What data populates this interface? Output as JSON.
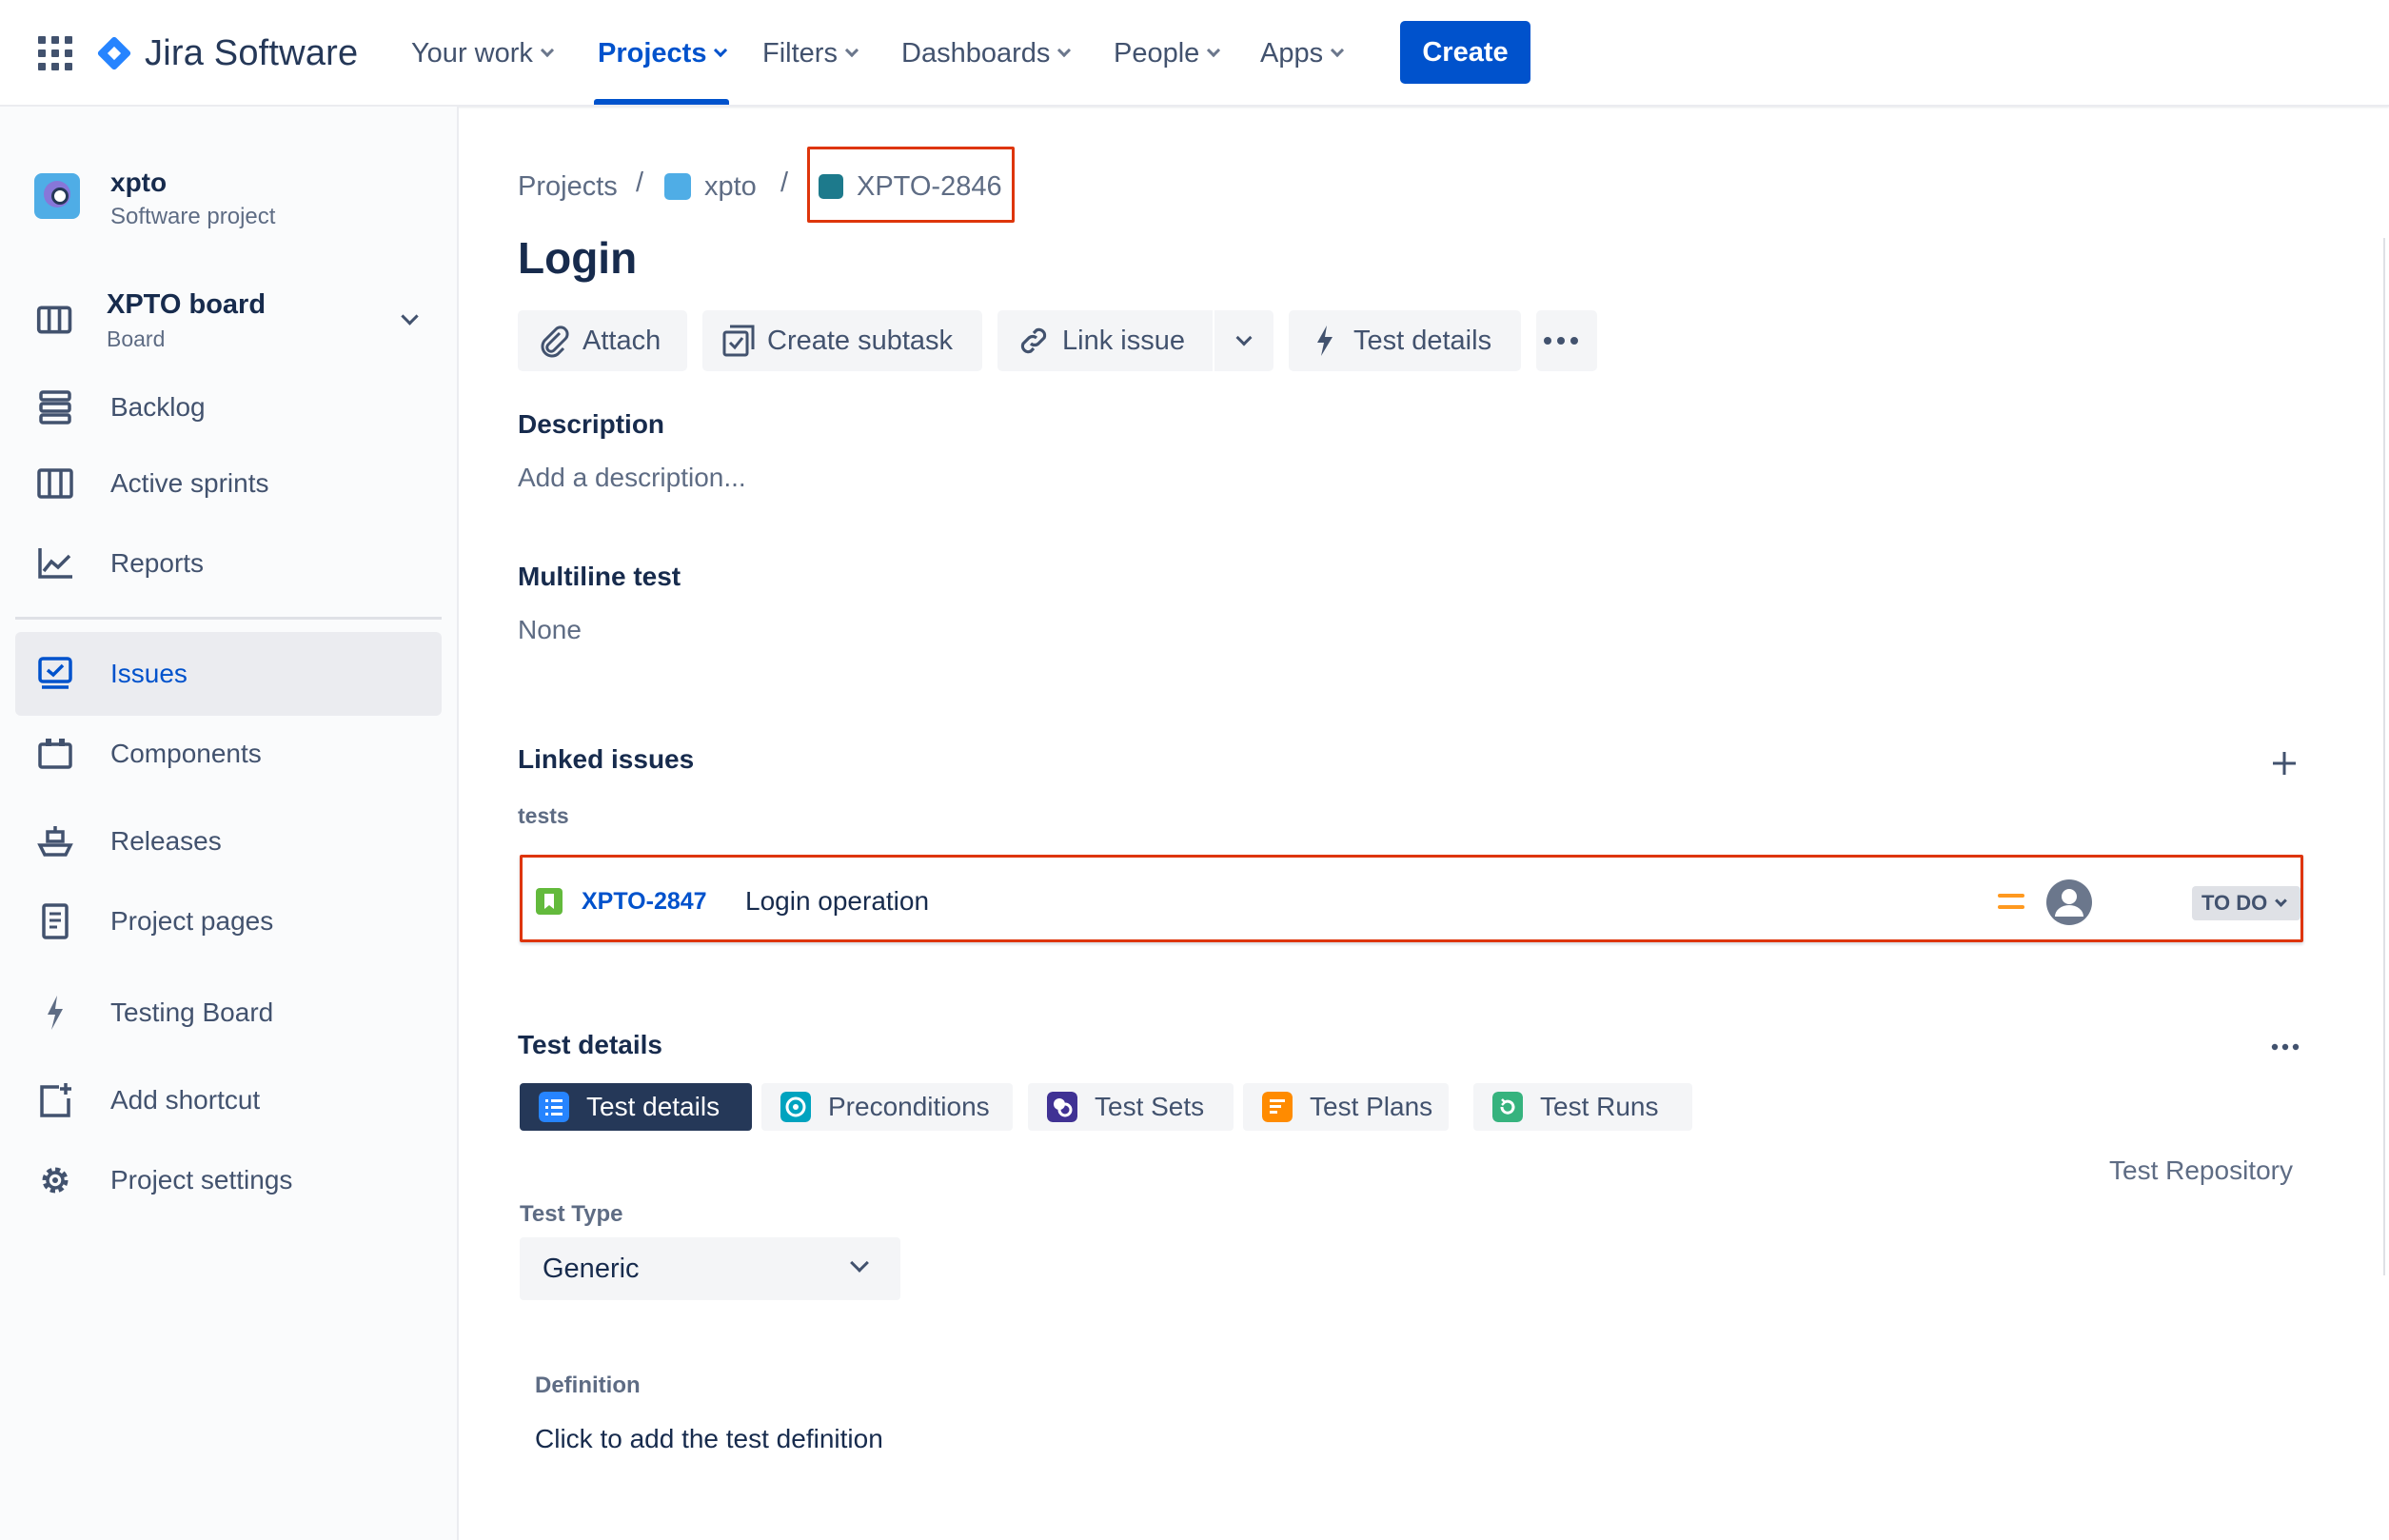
{
  "topnav": {
    "app_name": "Jira Software",
    "items": [
      {
        "label": "Your work"
      },
      {
        "label": "Projects"
      },
      {
        "label": "Filters"
      },
      {
        "label": "Dashboards"
      },
      {
        "label": "People"
      },
      {
        "label": "Apps"
      }
    ],
    "active_item": "Projects",
    "create_label": "Create",
    "accent": "#0052cc"
  },
  "sidebar": {
    "project_name": "xpto",
    "project_type": "Software project",
    "board_name": "XPTO board",
    "board_type": "Board",
    "items": [
      {
        "label": "Backlog",
        "icon": "backlog-icon"
      },
      {
        "label": "Active sprints",
        "icon": "columns-icon"
      },
      {
        "label": "Reports",
        "icon": "chart-icon"
      },
      {
        "label": "Issues",
        "icon": "issues-icon"
      },
      {
        "label": "Components",
        "icon": "components-icon"
      },
      {
        "label": "Releases",
        "icon": "ship-icon"
      },
      {
        "label": "Project pages",
        "icon": "page-icon"
      },
      {
        "label": "Testing Board",
        "icon": "lightning-icon"
      },
      {
        "label": "Add shortcut",
        "icon": "add-shortcut-icon"
      },
      {
        "label": "Project settings",
        "icon": "gear-icon"
      }
    ],
    "active_item": "Issues"
  },
  "breadcrumb": {
    "root": "Projects",
    "separator": "/",
    "project": "xpto",
    "issue_key": "XPTO-2846"
  },
  "issue": {
    "title": "Login",
    "actions": {
      "attach": "Attach",
      "create_subtask": "Create subtask",
      "link_issue": "Link issue",
      "test_details": "Test details"
    },
    "description": {
      "heading": "Description",
      "placeholder": "Add a description..."
    },
    "multiline_test": {
      "heading": "Multiline test",
      "value": "None"
    },
    "linked_issues": {
      "heading": "Linked issues",
      "relation": "tests",
      "items": [
        {
          "key": "XPTO-2847",
          "summary": "Login operation",
          "status": "TO DO",
          "priority": "medium",
          "priority_color": "#ff991f"
        }
      ]
    },
    "test_details": {
      "heading": "Test details",
      "tabs": [
        {
          "label": "Test details"
        },
        {
          "label": "Preconditions"
        },
        {
          "label": "Test Sets"
        },
        {
          "label": "Test Plans"
        },
        {
          "label": "Test Runs"
        }
      ],
      "active_tab": "Test details",
      "repository_link": "Test Repository",
      "test_type_label": "Test Type",
      "test_type_value": "Generic",
      "definition_label": "Definition",
      "definition_placeholder": "Click to add the test definition"
    }
  },
  "colors": {
    "highlight": "#de350b",
    "story_green": "#63ba3c",
    "dark_tab": "#253858"
  }
}
